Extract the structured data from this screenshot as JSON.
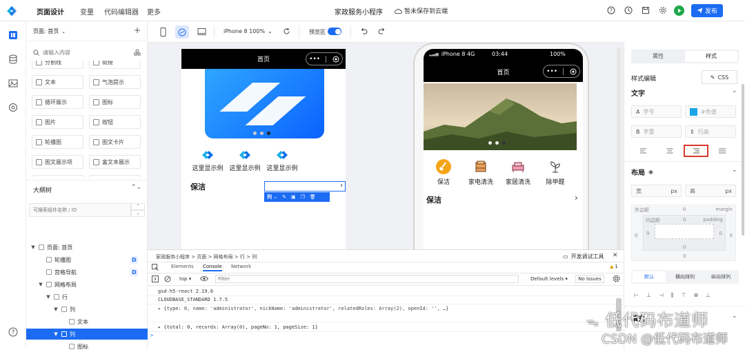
{
  "topbar": {
    "nav": [
      "页面设计",
      "变量",
      "代码编辑器",
      "更多"
    ],
    "app_title": "家政服务小程序",
    "save_status": "暂未保存到云端",
    "publish_label": "发布"
  },
  "left_panel": {
    "page_selector": "页面: 首页",
    "search_placeholder": "请输入内容",
    "components": [
      [
        "分割线",
        "链接"
      ],
      [
        "文本",
        "气泡提示"
      ],
      [
        "循环展示",
        "图标"
      ],
      [
        "图片",
        "按钮"
      ],
      [
        "轮播图",
        "图文卡片"
      ],
      [
        "图文展示项",
        "富文本展示"
      ],
      [
        "",
        ""
      ]
    ],
    "outline_title": "大纲树",
    "outline_search_placeholder": "可搜索组件名称 / ID",
    "tree": [
      {
        "label": "页面: 首页",
        "depth": 0,
        "arrow": "▼",
        "badge": ""
      },
      {
        "label": "轮播图",
        "depth": 1,
        "arrow": "",
        "badge": "D"
      },
      {
        "label": "宫格导航",
        "depth": 1,
        "arrow": "",
        "badge": "D"
      },
      {
        "label": "网格布局",
        "depth": 1,
        "arrow": "▼",
        "badge": ""
      },
      {
        "label": "行",
        "depth": 2,
        "arrow": "▼",
        "badge": ""
      },
      {
        "label": "列",
        "depth": 3,
        "arrow": "▼",
        "badge": ""
      },
      {
        "label": "文本",
        "depth": 4,
        "arrow": "",
        "badge": ""
      },
      {
        "label": "列",
        "depth": 3,
        "arrow": "▼",
        "badge": "",
        "selected": true
      },
      {
        "label": "图标",
        "depth": 4,
        "arrow": "",
        "badge": ""
      }
    ]
  },
  "toolbar": {
    "device": "iPhone 8 100%",
    "preview_label": "预览区",
    "preview_on": true
  },
  "phone_left": {
    "nav_title": "首页",
    "grid_items": [
      "这里显示例",
      "这里显示例",
      "这里显示例"
    ],
    "section_title": "保洁",
    "selection_label": "列"
  },
  "phone_right": {
    "status_left": "iPhone 8  4G",
    "status_time": "03:44",
    "status_battery": "100%",
    "nav_title": "首页",
    "grid_items": [
      "保洁",
      "家电清洗",
      "家居清洗",
      "除甲醛"
    ],
    "section_title": "保洁"
  },
  "devtools": {
    "breadcrumb": [
      "家政服务小程序",
      "页面",
      "网格布局",
      "行",
      "列"
    ],
    "close_label": "开发调试工具",
    "tabs": [
      "Elements",
      "Console",
      "Network"
    ],
    "active_tab": "Console",
    "warning_count": "1",
    "context": "top",
    "filter_placeholder": "Filter",
    "levels": "Default levels",
    "issues": "No Issues",
    "lines": [
      "gsd-h5-react 2.19.6",
      "CLOUDBASE_STANDARD 1.7.5",
      "▸ {type: 0, name: 'administrator', nickName: 'administrator', relatedRoles: Array(2), openId: '', …}",
      "▸ {total: 0, records: Array(0), pageNo: 1, pageSize: 1}",
      ">"
    ]
  },
  "right_panel": {
    "tabs": [
      "属性",
      "样式"
    ],
    "active_tab": "样式",
    "style_edit_label": "样式编辑",
    "css_label": "CSS",
    "text_section": "文字",
    "font_size_placeholder": "字号",
    "color_placeholder": "#色值",
    "font_weight_placeholder": "字重",
    "line_height_placeholder": "行高",
    "layout_section": "布局",
    "width_unit": "px",
    "height_unit": "px",
    "margin_label": "外边距",
    "margin_right_label": "margin",
    "padding_label": "内边距",
    "padding_right_label": "padding",
    "zero": "0",
    "flow_options": [
      "默认",
      "横向排列",
      "纵向排列"
    ],
    "active_flow": "默认",
    "collapsed_section": "填充"
  },
  "watermark": {
    "line1": "低代码布道师",
    "line2": "CSDN @低代码布道师"
  },
  "colors": {
    "accent": "#1c6cf3",
    "run": "#1ea84a",
    "highlight": "#d9362b"
  }
}
